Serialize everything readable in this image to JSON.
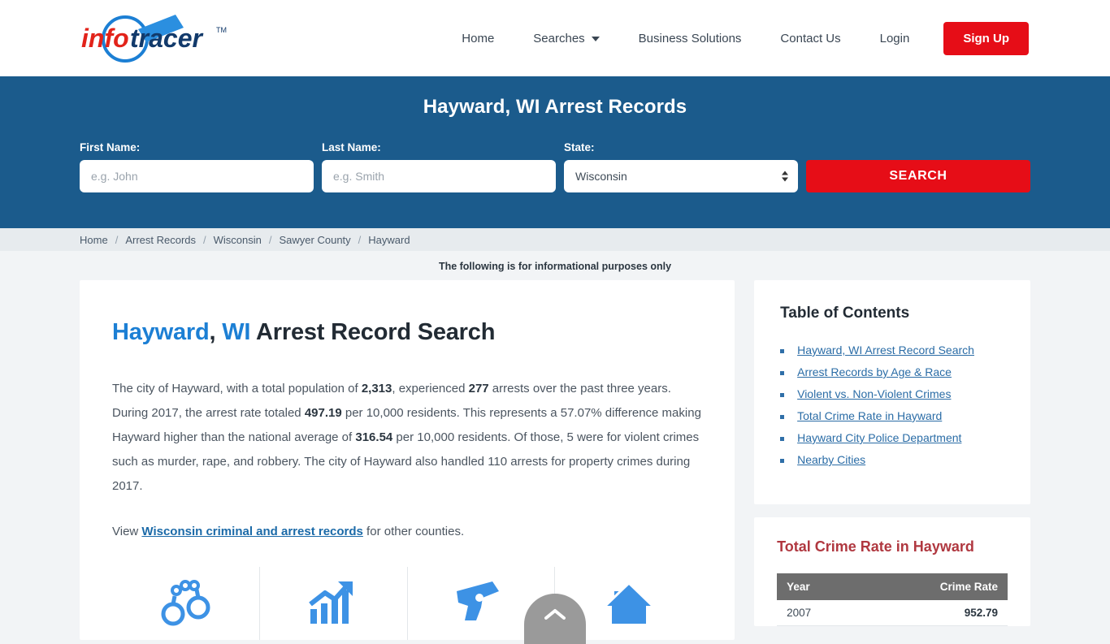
{
  "colors": {
    "hero_blue": "#1b5b8c",
    "accent_red": "#e60d17",
    "link_blue": "#2a6ca6",
    "heading_blue": "#1c7fd4",
    "crime_red": "#b03840",
    "icon_blue": "#3d92e5",
    "table_header_gray": "#6d6d6d"
  },
  "brand": {
    "logo_primary": "info",
    "logo_secondary": "tracer",
    "logo_tm": "TM",
    "logo_icon": "magnifying-glass-icon"
  },
  "nav": {
    "items": [
      {
        "label": "Home",
        "has_caret": false
      },
      {
        "label": "Searches",
        "has_caret": true
      },
      {
        "label": "Business Solutions",
        "has_caret": false
      },
      {
        "label": "Contact Us",
        "has_caret": false
      },
      {
        "label": "Login",
        "has_caret": false
      }
    ],
    "signup_label": "Sign Up"
  },
  "hero": {
    "title": "Hayward, WI Arrest Records",
    "first_name_label": "First Name:",
    "first_name_placeholder": "e.g. John",
    "first_name_value": "",
    "last_name_label": "Last Name:",
    "last_name_placeholder": "e.g. Smith",
    "last_name_value": "",
    "state_label": "State:",
    "state_value": "Wisconsin",
    "state_options": [
      "Wisconsin"
    ],
    "search_label": "SEARCH"
  },
  "breadcrumb": {
    "separator": "/",
    "items": [
      "Home",
      "Arrest Records",
      "Wisconsin",
      "Sawyer County",
      "Hayward"
    ]
  },
  "notice": "The following is for informational purposes only",
  "main": {
    "heading_city": "Hayward",
    "heading_comma": ", ",
    "heading_state": "WI",
    "heading_rest": " Arrest Record Search",
    "paragraph": {
      "p1": "The city of Hayward, with a total population of ",
      "population": "2,313",
      "p2": ", experienced ",
      "arrests": "277",
      "p3": " arrests over the past three years. During 2017, the arrest rate totaled ",
      "arrest_rate": "497.19",
      "p4": " per 10,000 residents. This represents a 57.07% difference making Hayward higher than the national average of ",
      "national_average": "316.54",
      "p5": " per 10,000 residents. Of those, 5 were for violent crimes such as murder, rape, and robbery. The city of Hayward also handled 110 arrests for property crimes during 2017."
    },
    "view_line": {
      "prefix": "View ",
      "link": "Wisconsin criminal and arrest records",
      "suffix": " for other counties."
    },
    "icons": [
      {
        "name": "handcuffs-icon"
      },
      {
        "name": "growth-chart-icon"
      },
      {
        "name": "handgun-icon"
      },
      {
        "name": "house-icon"
      }
    ]
  },
  "sidebar": {
    "toc_title": "Table of Contents",
    "toc_items": [
      "Hayward, WI Arrest Record Search",
      "Arrest Records by Age & Race",
      "Violent vs. Non-Violent Crimes",
      "Total Crime Rate in Hayward",
      "Hayward City Police Department",
      "Nearby Cities"
    ],
    "rate_panel": {
      "title": "Total Crime Rate in Hayward",
      "columns": [
        "Year",
        "Crime Rate"
      ],
      "rows": [
        {
          "year": "2007",
          "rate": "952.79"
        }
      ]
    }
  },
  "scroll_top": {
    "icon": "chevron-up-icon"
  }
}
